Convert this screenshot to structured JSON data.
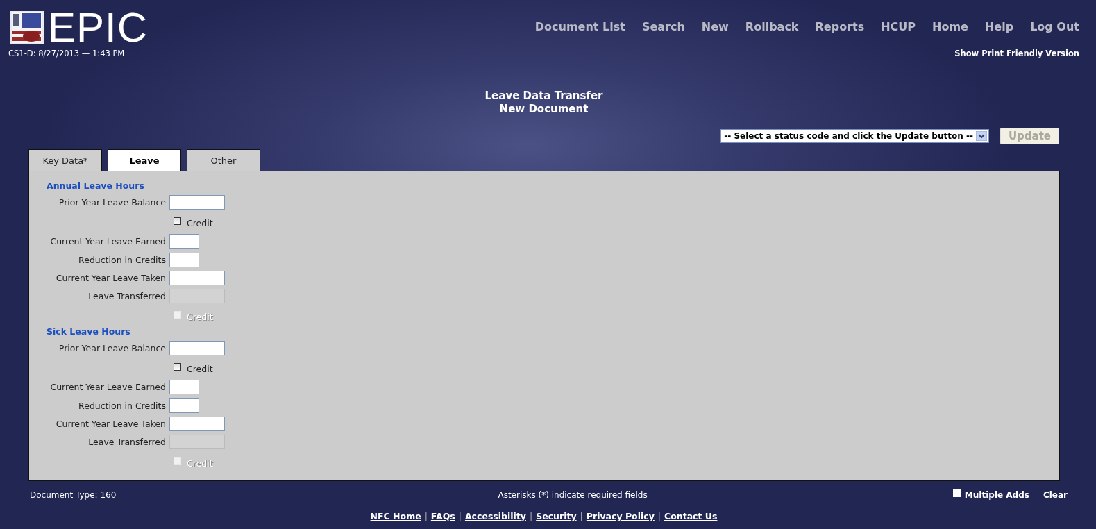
{
  "header": {
    "brand": "EPIC",
    "timestamp": "CS1-D: 8/27/2013 — 1:43 PM",
    "nav": [
      "Document List",
      "Search",
      "New",
      "Rollback",
      "Reports",
      "HCUP",
      "Home",
      "Help",
      "Log Out"
    ],
    "print_link": "Show Print Friendly Version"
  },
  "page_title": [
    "Leave Data Transfer",
    "New Document"
  ],
  "status_select": {
    "value": "-- Select a status code and click the Update button --"
  },
  "update_button": {
    "label": "Update",
    "disabled": true
  },
  "tabs": [
    {
      "label": "Key Data*",
      "selected": false
    },
    {
      "label": "Leave",
      "selected": true
    },
    {
      "label": "Other",
      "selected": false
    }
  ],
  "sections": [
    {
      "title": "Annual Leave Hours",
      "rows": [
        {
          "kind": "field",
          "label": "Prior Year Leave Balance",
          "disabled": false
        },
        {
          "kind": "checkbox",
          "label": "Credit",
          "checked": false,
          "disabled": false
        },
        {
          "kind": "shortfield",
          "label": "Current Year Leave Earned",
          "disabled": false
        },
        {
          "kind": "shortfield",
          "label": "Reduction in Credits",
          "disabled": false
        },
        {
          "kind": "field",
          "label": "Current Year Leave Taken",
          "disabled": false
        },
        {
          "kind": "field",
          "label": "Leave Transferred",
          "disabled": true
        },
        {
          "kind": "checkbox",
          "label": "Credit",
          "checked": false,
          "disabled": true
        }
      ]
    },
    {
      "title": "Sick Leave Hours",
      "rows": [
        {
          "kind": "field",
          "label": "Prior Year Leave Balance",
          "disabled": false
        },
        {
          "kind": "checkbox",
          "label": "Credit",
          "checked": false,
          "disabled": false
        },
        {
          "kind": "shortfield",
          "label": "Current Year Leave Earned",
          "disabled": false
        },
        {
          "kind": "shortfield",
          "label": "Reduction in Credits",
          "disabled": false
        },
        {
          "kind": "field",
          "label": "Current Year Leave Taken",
          "disabled": false
        },
        {
          "kind": "field",
          "label": "Leave Transferred",
          "disabled": true
        },
        {
          "kind": "checkbox",
          "label": "Credit",
          "checked": false,
          "disabled": true
        }
      ]
    }
  ],
  "bottom_bar": {
    "document_type": "Document Type: 160",
    "note": "Asterisks (*) indicate required fields",
    "multiple_adds": {
      "label": "Multiple Adds",
      "checked": false
    },
    "clear": "Clear"
  },
  "footer": {
    "links": [
      "NFC Home",
      "FAQs",
      "Accessibility",
      "Security",
      "Privacy Policy",
      "Contact Us"
    ],
    "separator": "|"
  }
}
